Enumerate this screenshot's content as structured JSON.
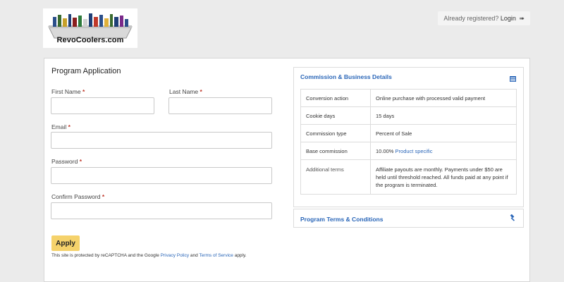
{
  "brand": {
    "logo_text": "RevoCoolers.com"
  },
  "header": {
    "already_registered": "Already registered?",
    "login_label": "Login",
    "login_icon": "sign-in-icon"
  },
  "form": {
    "title": "Program Application",
    "required_mark": "*",
    "first_name_label": "First Name",
    "last_name_label": "Last Name",
    "email_label": "Email",
    "password_label": "Password",
    "confirm_password_label": "Confirm Password",
    "apply_label": "Apply",
    "recaptcha_text_1": "This site is protected by reCAPTCHA and the Google",
    "privacy_policy": "Privacy Policy",
    "recaptcha_and": "and",
    "terms_of_service": "Terms of Service",
    "recaptcha_text_2": "apply."
  },
  "commission_panel": {
    "title": "Commission & Business Details",
    "icon": "list-icon",
    "rows": [
      {
        "label": "Conversion action",
        "value": "Online purchase with processed valid payment"
      },
      {
        "label": "Cookie days",
        "value": "15 days"
      },
      {
        "label": "Commission type",
        "value": "Percent of Sale"
      },
      {
        "label": "Base commission",
        "value": "10.00%",
        "link": "Product specific"
      },
      {
        "label": "Additional terms",
        "value": "Affiliate payouts are monthly. Payments under $50 are held until threshold reached. All funds paid at any point if the program is terminated."
      }
    ]
  },
  "terms_panel": {
    "title": "Program Terms & Conditions",
    "icon": "gavel-icon"
  },
  "colors": {
    "link": "#2a66b8",
    "apply_button": "#f5d26b",
    "required": "#c0392b",
    "background": "#ebebeb"
  }
}
